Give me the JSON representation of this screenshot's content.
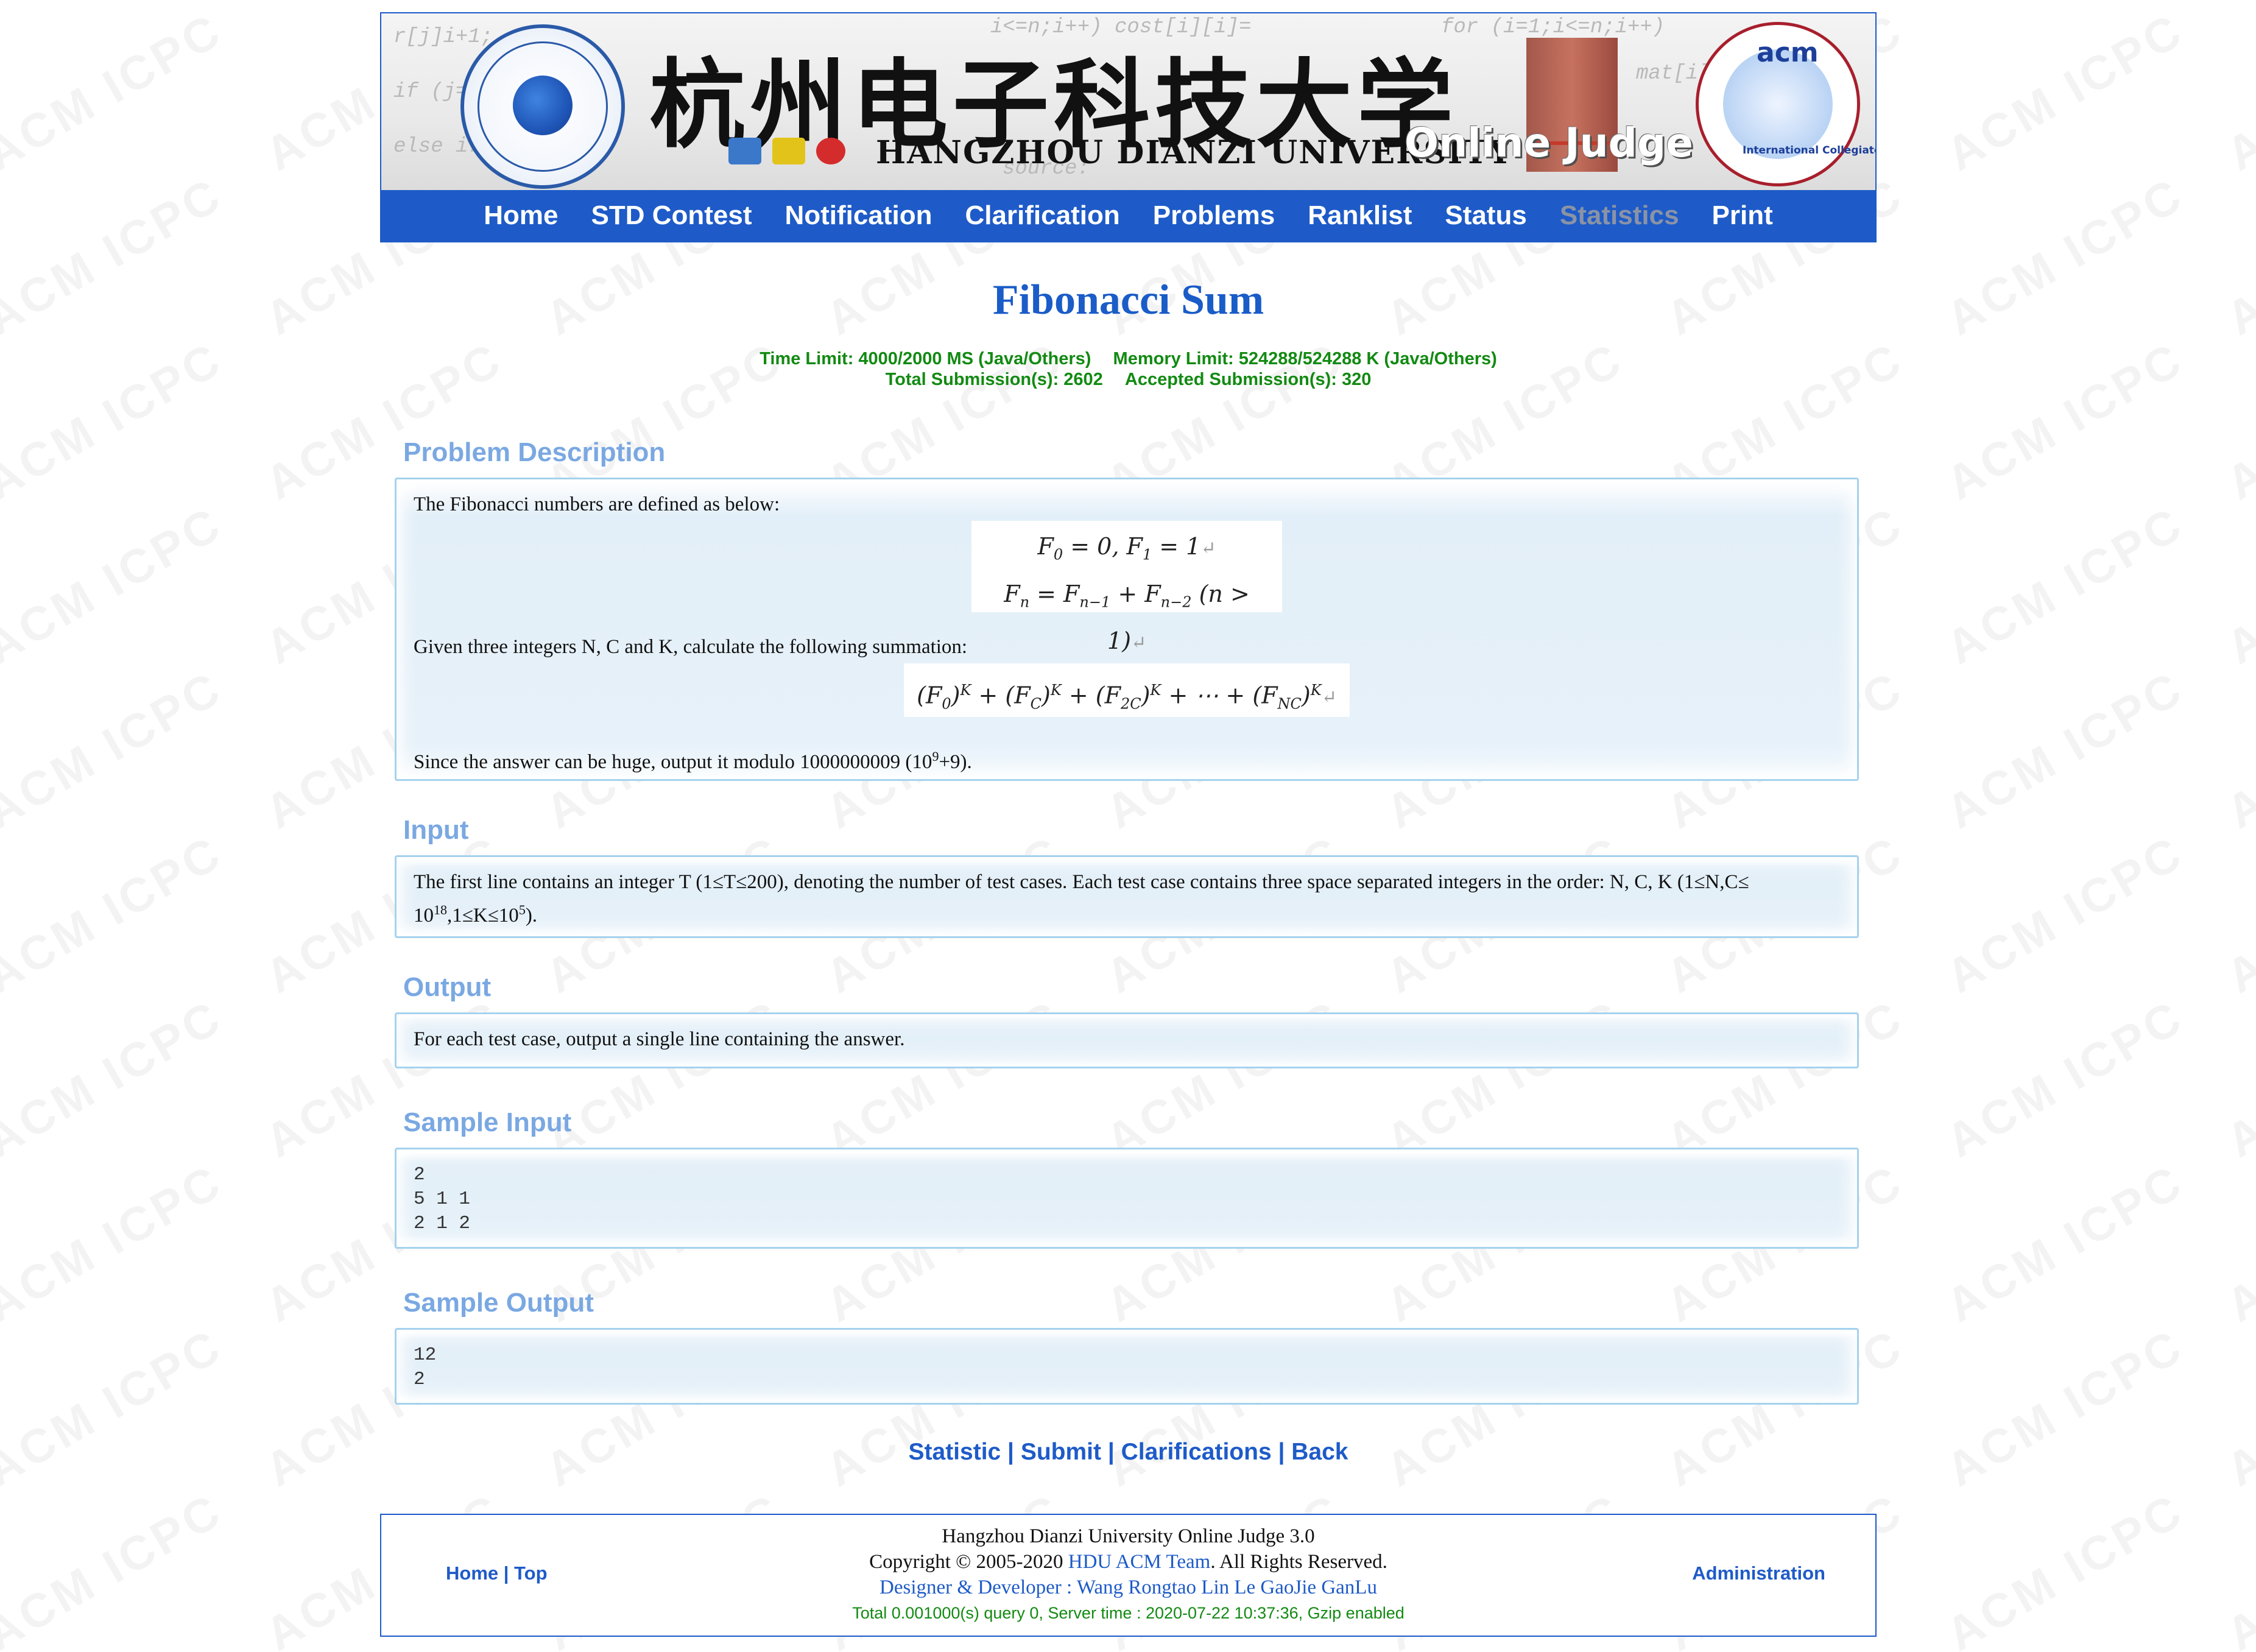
{
  "banner": {
    "chinese_title": "杭州电子科技大学",
    "english_title": "HANGZHOU DIANZI UNIVERSITY",
    "online_judge": "Online Judge",
    "acm_logo_text": "acm",
    "acm_ring_text": "International Collegiate Programming Contest"
  },
  "nav": {
    "items": [
      {
        "label": "Home"
      },
      {
        "label": "STD Contest"
      },
      {
        "label": "Notification"
      },
      {
        "label": "Clarification"
      },
      {
        "label": "Problems"
      },
      {
        "label": "Ranklist"
      },
      {
        "label": "Status"
      },
      {
        "label": "Statistics"
      },
      {
        "label": "Print"
      }
    ]
  },
  "watermark": "ACM ICPC",
  "problem": {
    "title": "Fibonacci Sum",
    "time_limit": "Time Limit: 4000/2000 MS (Java/Others)",
    "memory_limit": "Memory Limit: 524288/524288 K (Java/Others)",
    "total_submissions": "Total Submission(s): 2602",
    "accepted_submissions": "Accepted Submission(s): 320"
  },
  "sections": {
    "description": {
      "title": "Problem Description",
      "line1": "The Fibonacci numbers are defined as below:",
      "line2": "Given three integers N, C and K, calculate the following summation:",
      "line3_pre": "Since the answer can be huge, output it modulo 1000000009 (10",
      "line3_sup": "9",
      "line3_post": "+9)."
    },
    "input": {
      "title": "Input",
      "text_pre": "The first line contains an integer T (1≤T≤200), denoting the number of test cases. Each test case contains three space separated integers in the order: N, C, K (1≤N,C≤ 10",
      "sup1": "18",
      "text_mid": ",1≤K≤10",
      "sup2": "5",
      "text_post": ")."
    },
    "output": {
      "title": "Output",
      "text": "For each test case, output a single line containing the answer."
    },
    "sample_input": {
      "title": "Sample Input",
      "lines": [
        "2",
        "5 1 1",
        "2 1 2"
      ]
    },
    "sample_output": {
      "title": "Sample Output",
      "lines": [
        "12",
        "2"
      ]
    }
  },
  "bottom_links": {
    "statistic": "Statistic",
    "submit": "Submit",
    "clarifications": "Clarifications",
    "back": "Back",
    "sep": " | "
  },
  "footer": {
    "home": "Home",
    "top": "Top",
    "sep": " | ",
    "admin": "Administration",
    "line1": "Hangzhou Dianzi University Online Judge 3.0",
    "copyright_pre": "Copyright © 2005-2020 ",
    "team": "HDU ACM Team",
    "copyright_post": ". All Rights Reserved.",
    "designer": "Designer & Developer : Wang Rongtao Lin Le GaoJie GanLu",
    "server": "Total 0.001000(s) query 0, Server time : 2020-07-22 10:37:36, Gzip enabled"
  }
}
